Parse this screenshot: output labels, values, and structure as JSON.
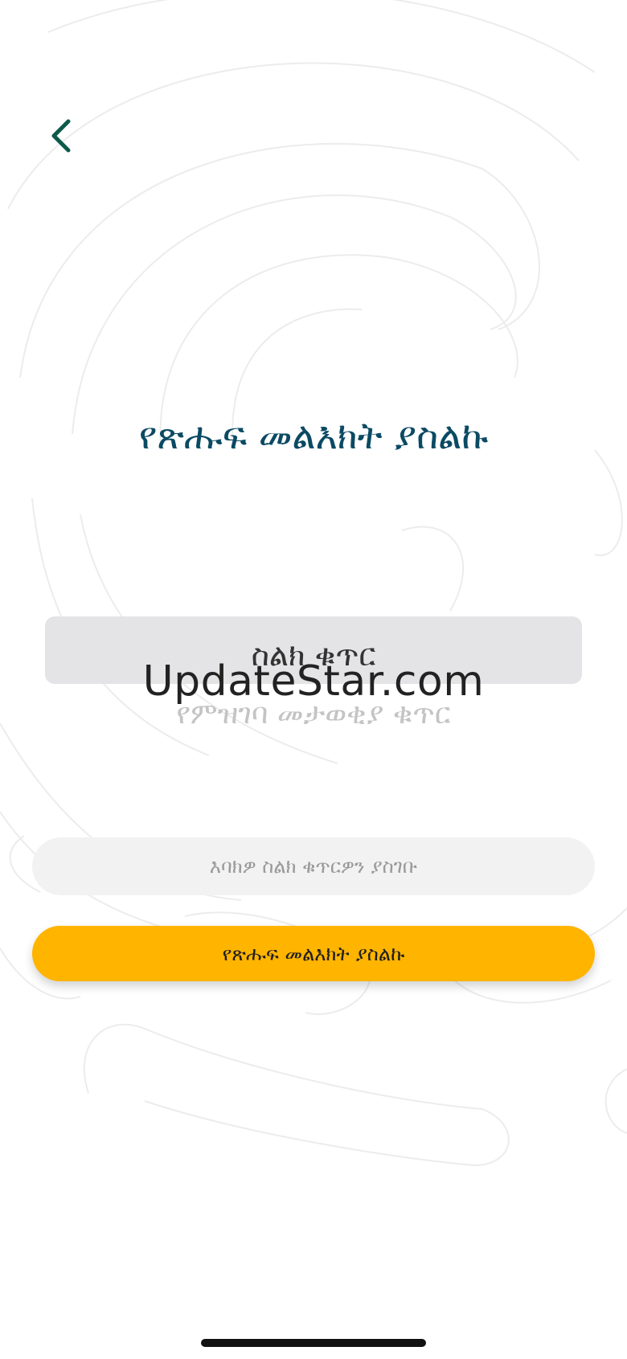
{
  "header": {
    "back_icon": "chevron-left-icon"
  },
  "main": {
    "title": "የጽሑፍ መልእክት ያስልኩ",
    "tabs": {
      "phone_number": "ስልክ ቁጥር",
      "registration_id": "የምዝገባ መታወቂያ ቁጥር"
    },
    "phone_input": {
      "placeholder": "እባክዎ ስልክ ቁጥርዎን ያስገቡ",
      "value": ""
    },
    "submit_label": "የጽሑፍ መልእክት ያስልኩ"
  },
  "watermark": "UpdateStar.com",
  "colors": {
    "primary": "#0b4a63",
    "back_icon": "#0e5a4a",
    "accent": "#ffb400",
    "input_bg": "#f2f2f2",
    "tab_active_bg": "#e4e4e6"
  }
}
